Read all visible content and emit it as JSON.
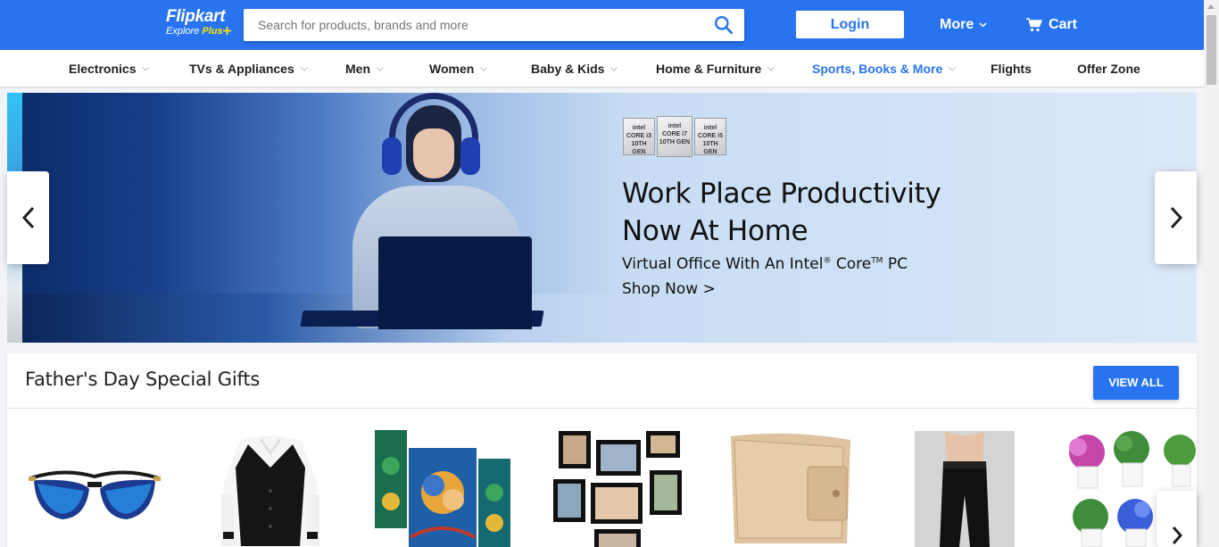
{
  "header": {
    "logo": {
      "main": "Flipkart",
      "sub": "Explore",
      "plus": "Plus"
    },
    "search": {
      "placeholder": "Search for products, brands and more"
    },
    "login_label": "Login",
    "more_label": "More",
    "cart_label": "Cart",
    "brand_color": "#2874f0"
  },
  "categories": [
    {
      "label": "Electronics",
      "has_dropdown": true
    },
    {
      "label": "TVs & Appliances",
      "has_dropdown": true
    },
    {
      "label": "Men",
      "has_dropdown": true
    },
    {
      "label": "Women",
      "has_dropdown": true
    },
    {
      "label": "Baby & Kids",
      "has_dropdown": true
    },
    {
      "label": "Home & Furniture",
      "has_dropdown": true
    },
    {
      "label": "Sports, Books & More",
      "has_dropdown": true,
      "active": true
    },
    {
      "label": "Flights",
      "has_dropdown": false
    },
    {
      "label": "Offer Zone",
      "has_dropdown": false
    }
  ],
  "banner": {
    "badges": [
      {
        "brand": "intel",
        "line": "CORE i3",
        "gen": "10TH GEN"
      },
      {
        "brand": "intel",
        "line": "CORE i7",
        "gen": "10TH GEN"
      },
      {
        "brand": "intel",
        "line": "CORE i5",
        "gen": "10TH GEN"
      }
    ],
    "title_line1": "Work Place Productivity",
    "title_line2": "Now At Home",
    "subtitle_a": "Virtual Office With An Intel",
    "subtitle_reg": "®",
    "subtitle_b": " Core",
    "subtitle_tm": "TM",
    "subtitle_c": " PC",
    "cta": "Shop Now >"
  },
  "section": {
    "title": "Father's Day Special Gifts",
    "view_all_label": "VIEW ALL",
    "products": [
      {
        "name": "sunglasses-product"
      },
      {
        "name": "waistcoat-shirt-product"
      },
      {
        "name": "krishna-painting-product"
      },
      {
        "name": "photo-frames-product"
      },
      {
        "name": "wallet-product"
      },
      {
        "name": "jogger-pants-product"
      },
      {
        "name": "artificial-flowers-product"
      }
    ]
  }
}
